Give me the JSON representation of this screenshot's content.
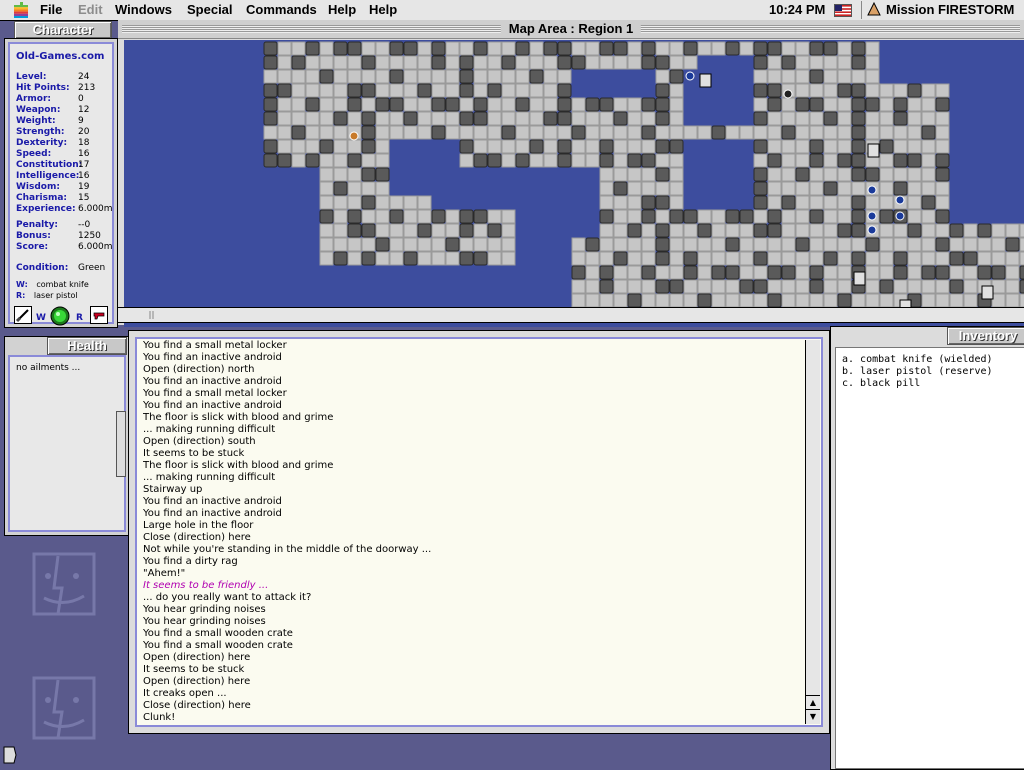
{
  "menubar": {
    "items": [
      "File",
      "Edit",
      "Windows",
      "Special",
      "Commands",
      "Help",
      "Help"
    ],
    "clock": "10:24 PM",
    "app_name": "Mission FIRESTORM"
  },
  "character": {
    "tab": "Character",
    "name": "Old-Games.com",
    "stats": [
      {
        "label": "Level:",
        "value": "24"
      },
      {
        "label": "Hit Points:",
        "value": "213"
      },
      {
        "label": "Armor:",
        "value": "0"
      },
      {
        "label": "Weapon:",
        "value": "12"
      },
      {
        "label": "Weight:",
        "value": "9"
      },
      {
        "label": "Strength:",
        "value": "20"
      },
      {
        "label": "Dexterity:",
        "value": "18"
      },
      {
        "label": "Speed:",
        "value": "16"
      },
      {
        "label": "Constitution:",
        "value": "17"
      },
      {
        "label": "Intelligence:",
        "value": "16"
      },
      {
        "label": "Wisdom:",
        "value": "19"
      },
      {
        "label": "Charisma:",
        "value": "15"
      },
      {
        "label": "Experience:",
        "value": "6.000m"
      }
    ],
    "stats2": [
      {
        "label": "Penalty:",
        "value": "--0"
      },
      {
        "label": "Bonus:",
        "value": "1250"
      },
      {
        "label": "Score:",
        "value": "6.000m"
      }
    ],
    "condition_label": "Condition:",
    "condition_value": "Green",
    "wielded_key": "W:",
    "wielded_value": "combat knife",
    "reserve_key": "R:",
    "reserve_value": "laser pistol",
    "icon_labels": {
      "w": "W",
      "r": "R"
    }
  },
  "map": {
    "title": "Map Area : Region 1"
  },
  "health": {
    "tab": "Health",
    "text": "no ailments ..."
  },
  "messages": [
    {
      "t": "You find a small metal locker"
    },
    {
      "t": "You find an inactive android"
    },
    {
      "t": "Open (direction) north"
    },
    {
      "t": "You find an inactive android"
    },
    {
      "t": "You find a small metal locker"
    },
    {
      "t": "You find an inactive android"
    },
    {
      "t": "The floor is slick with blood and grime"
    },
    {
      "t": "... making running difficult"
    },
    {
      "t": "Open (direction) south"
    },
    {
      "t": "It seems to be stuck"
    },
    {
      "t": "The floor is slick with blood and grime"
    },
    {
      "t": "... making running difficult"
    },
    {
      "t": "Stairway up"
    },
    {
      "t": "You find an inactive android"
    },
    {
      "t": "You find an inactive android"
    },
    {
      "t": "Large hole in the floor"
    },
    {
      "t": "Close (direction) here"
    },
    {
      "t": "Not while you're standing in the middle of the doorway ..."
    },
    {
      "t": "You find a dirty rag"
    },
    {
      "t": "\"Ahem!\""
    },
    {
      "t": "It seems to be friendly ...",
      "style": "italic"
    },
    {
      "t": "... do you really want to attack it?"
    },
    {
      "t": "You hear grinding noises"
    },
    {
      "t": "You hear grinding noises"
    },
    {
      "t": "You find a small wooden crate"
    },
    {
      "t": "You find a small wooden crate"
    },
    {
      "t": "Open (direction) here"
    },
    {
      "t": "It seems to be stuck"
    },
    {
      "t": "Open (direction) here"
    },
    {
      "t": "It creaks open ..."
    },
    {
      "t": "Close (direction) here"
    },
    {
      "t": "Clunk!"
    }
  ],
  "inventory": {
    "tab": "Inventory",
    "items": [
      "a. combat knife (wielded)",
      "b. laser pistol (reserve)",
      "c. black pill"
    ]
  },
  "colors": {
    "map_water": "#3d4d9e",
    "floor": "#c6c6c6",
    "wall": "#5a5a5a",
    "accent_border": "#8a8ad8",
    "label_blue": "#1a1aa8"
  },
  "icons": [
    "apple-icon",
    "flag-icon",
    "app-icon",
    "knife-icon",
    "pistol-icon",
    "status-orb-icon"
  ]
}
